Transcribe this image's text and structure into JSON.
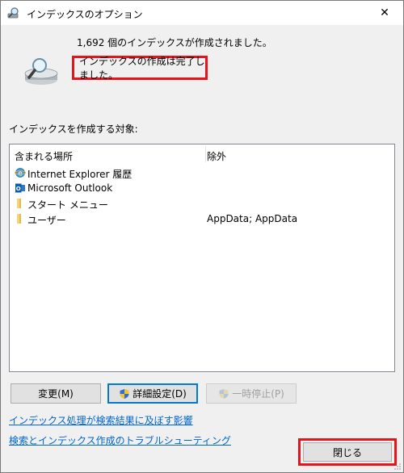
{
  "window": {
    "title": "インデックスのオプション",
    "close_glyph": "✕"
  },
  "summary": {
    "indexed_count_text": "1,692 個のインデックスが作成されました。",
    "status_text": "インデックスの作成は完了しました。"
  },
  "index_section": {
    "label": "インデックスを作成する対象:",
    "columns": {
      "location": "含まれる場所",
      "exclude": "除外"
    },
    "rows": [
      {
        "location": "Internet Explorer 履歴",
        "exclude": "",
        "icon": "internet-explorer-icon"
      },
      {
        "location": "Microsoft Outlook",
        "exclude": "",
        "icon": "outlook-icon"
      },
      {
        "location": "スタート メニュー",
        "exclude": "",
        "icon": "folder-icon"
      },
      {
        "location": "ユーザー",
        "exclude": "AppData; AppData",
        "icon": "folder-icon"
      }
    ]
  },
  "buttons": {
    "modify": "変更(M)",
    "advanced": "詳細設定(D)",
    "pause": "一時停止(P)",
    "close": "閉じる"
  },
  "links": {
    "effect": "インデックス処理が検索結果に及ぼす影響",
    "troubleshoot": "検索とインデックス作成のトラブルシューティング"
  },
  "colors": {
    "highlight": "#e8141c",
    "link": "#0066cc",
    "accent": "#0078d7"
  }
}
